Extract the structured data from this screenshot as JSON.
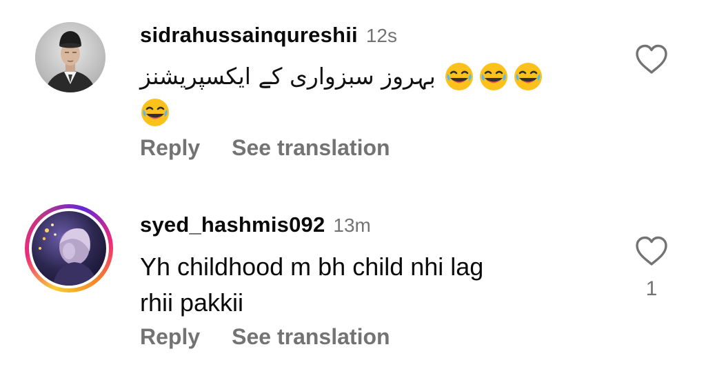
{
  "comments": [
    {
      "username": "sidrahussainqureshii",
      "time": "12s",
      "text_urdu": "بہروز سبزواری کے ایکسپریشنز",
      "emoji": "face-with-tears-of-joy",
      "avatar": "man-in-cap-avatar",
      "reply_label": "Reply",
      "translate_label": "See translation",
      "like_icon": "heart-outline-icon"
    },
    {
      "username": "syed_hashmis092",
      "time": "13m",
      "text_line1": "Yh childhood m bh child nhi lag",
      "text_line2": "rhii pakkii",
      "avatar": "story-avatar",
      "reply_label": "Reply",
      "translate_label": "See translation",
      "like_icon": "heart-outline-icon",
      "like_count": "1"
    }
  ],
  "colors": {
    "text": "#0a0a0a",
    "secondary": "#737373",
    "story_ring": [
      "#f9ce34",
      "#ee2a7b",
      "#6228d7"
    ]
  }
}
